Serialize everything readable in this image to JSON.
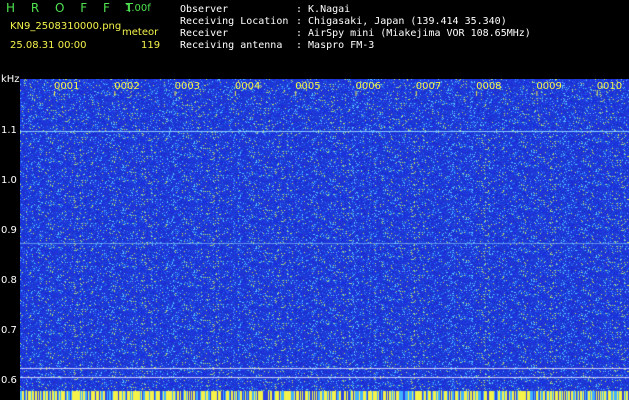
{
  "app": {
    "title": "H R O F F T",
    "version": "1.00f",
    "filename": "KN9_2508310000.png",
    "mode": "meteor",
    "datetime": "25.08.31 00:00",
    "count": "119"
  },
  "header": {
    "rows": [
      {
        "label": "Observer",
        "value": ": K.Nagai"
      },
      {
        "label": "Receiving Location",
        "value": ": Chigasaki, Japan (139.414 35.340)"
      },
      {
        "label": "Receiver",
        "value": ": AirSpy mini (Miakejima VOR 108.65MHz)"
      },
      {
        "label": "Receiving antenna",
        "value": ": Maspro FM-3"
      }
    ]
  },
  "spectrum": {
    "unit_label": "kHz",
    "y_ticks": [
      "1.1",
      "1.0",
      "0.9",
      "0.8",
      "0.7",
      "0.6"
    ],
    "minute_markers": [
      "0001",
      "0002",
      "0003",
      "0004",
      "0005",
      "0006",
      "0007",
      "0008",
      "0009",
      "0010"
    ],
    "colors": {
      "background": "#1a2fd8",
      "noise": "#3fb0ff",
      "marker": "#f5f34a",
      "axis": "#ffffff"
    }
  }
}
